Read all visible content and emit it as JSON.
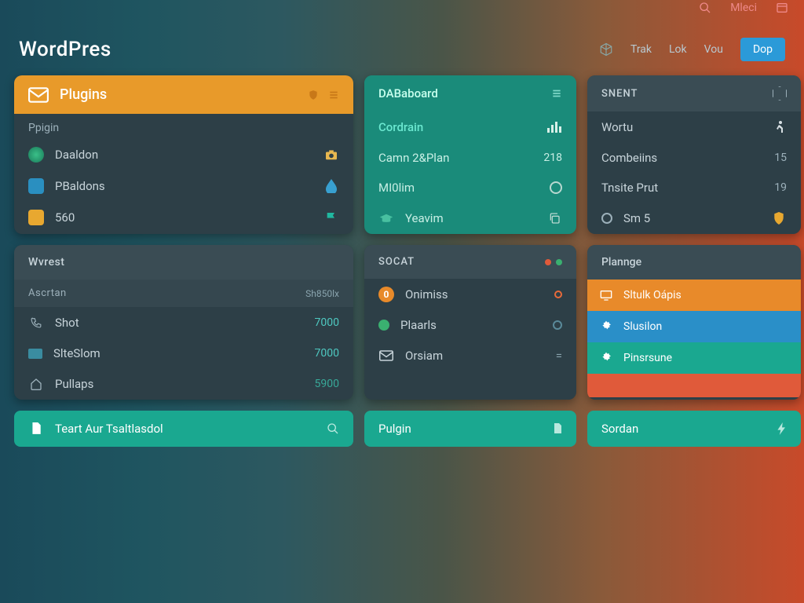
{
  "topbar": {
    "left": "",
    "search": "",
    "menu": "Mleci",
    "panel": ""
  },
  "header": {
    "title": "WordPres",
    "nav": {
      "trak": "Trak",
      "lok": "Lok",
      "vou": "Vou",
      "btn": "Dop"
    }
  },
  "cards": {
    "plugins": {
      "title": "Plugins",
      "sub": "Ppigin",
      "rows": [
        {
          "label": "Daaldon"
        },
        {
          "label": "PBaldons"
        },
        {
          "label": "560"
        }
      ]
    },
    "dashboard": {
      "title": "DABaboard",
      "rows": [
        {
          "label": "Cordrain",
          "val": ""
        },
        {
          "label": "Camn 2&Plan",
          "val": "218"
        },
        {
          "label": "MI0lim",
          "val": ""
        },
        {
          "label": "Yeavim",
          "val": ""
        }
      ]
    },
    "snent": {
      "title": "SNENT",
      "rows": [
        {
          "label": "Wortu",
          "val": ""
        },
        {
          "label": "Combeiins",
          "val": "15"
        },
        {
          "label": "Tnsite Prut",
          "val": "19"
        },
        {
          "label": "Sm 5",
          "val": ""
        }
      ]
    },
    "wvrest": {
      "title": "Wvrest",
      "rows": [
        {
          "label": "Ascrtan",
          "val": "Sh850lx"
        },
        {
          "label": "Shot",
          "val": "7000"
        },
        {
          "label": "SlteSlom",
          "val": "7000"
        },
        {
          "label": "Pullaps",
          "val": "5900"
        }
      ]
    },
    "socat": {
      "title": "SOCAT",
      "rows": [
        {
          "label": "Onimiss"
        },
        {
          "label": "Plaarls"
        },
        {
          "label": "Orsiam"
        }
      ]
    },
    "plange": {
      "title": "Plannge",
      "items": [
        {
          "label": "Sltulk Oápis"
        },
        {
          "label": "Slusilon"
        },
        {
          "label": "Pinsrsune"
        }
      ]
    }
  },
  "bottom": {
    "btn1": "Teart Aur Tsaltlasdol",
    "btn2": "Pulgin",
    "btn3": "Sordan"
  }
}
